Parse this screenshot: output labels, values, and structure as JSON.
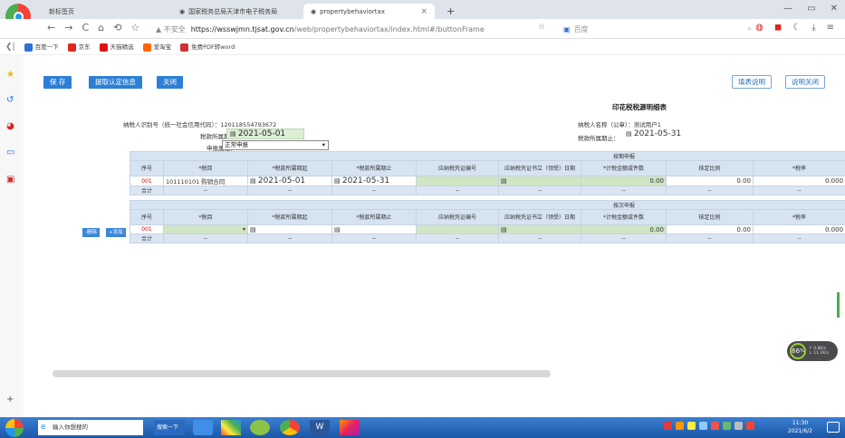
{
  "browser": {
    "tabs": [
      {
        "label": "新标签页",
        "active": false
      },
      {
        "label": "国家税务总局天津市电子税务局",
        "active": false
      },
      {
        "label": "propertybehaviortax",
        "active": true
      }
    ],
    "new_tab": "+",
    "window_controls": [
      "—",
      "▭",
      "✕"
    ],
    "nav": [
      "←",
      "→",
      "C",
      "⌂",
      "⟲",
      "☆"
    ],
    "security": "▲ 不安全",
    "url_host": "https://wsswjmn.tjsat.gov.cn",
    "url_path": "/web/propertybehaviortax/index.html#/buttonFrame",
    "search_engine": "百度",
    "bookmarks": [
      {
        "label": "百度一下",
        "color": "#2f6fd6"
      },
      {
        "label": "京东",
        "color": "#e1251b"
      },
      {
        "label": "天猫精选",
        "color": "#d11"
      },
      {
        "label": "爱淘宝",
        "color": "#f60"
      },
      {
        "label": "免费PDF转word",
        "color": "#c33"
      }
    ]
  },
  "toolbar": {
    "save_label": "保 存",
    "extract_label": "提取认定信息",
    "close_label": "关闭",
    "help_label": "填表说明",
    "help_close_label": "说明关闭"
  },
  "form": {
    "title": "印花税税源明细表",
    "taxpayer_id_label": "纳税人识别号（统一社会信用代码）：",
    "taxpayer_id": "120118554793672",
    "taxpayer_name_label": "纳税人名称（公章）：",
    "taxpayer_name": "测试用户1",
    "period_start_label": "税款所属期起：",
    "period_start": "2021-05-01",
    "period_end_label": "税款所属期止：",
    "period_end": "2021-05-31",
    "declare_attr_label": "申报属性：",
    "declare_attr_value": "正常申报"
  },
  "headers": [
    "序号",
    "*税目",
    "*税款所属期起",
    "*税款所属期止",
    "应纳税凭证编号",
    "应纳税凭证书立（领受）日期",
    "*计税金额或件数",
    "核定比例",
    "*税率"
  ],
  "period_section": {
    "title": "按期申报",
    "row": {
      "no": "001",
      "item": "101110101 购销合同",
      "start": "2021-05-01",
      "end": "2021-05-31",
      "voucher_no": "",
      "voucher_date": "",
      "amount": "0.00",
      "ratio": "0.00",
      "rate": "0.000"
    },
    "sum_label": "合计",
    "sum_values": [
      "--",
      "--",
      "--",
      "--",
      "--",
      "--",
      "--",
      "--"
    ]
  },
  "each_section": {
    "title": "按次申报",
    "delete_label": "-删除",
    "add_label": "+添加",
    "row": {
      "no": "001",
      "item": "",
      "start": "",
      "end": "",
      "voucher_no": "",
      "voucher_date": "",
      "amount": "0.00",
      "ratio": "0.00",
      "rate": "0.000"
    },
    "sum_label": "合计",
    "sum_values": [
      "--",
      "--",
      "--",
      "--",
      "--",
      "--",
      "--",
      "--"
    ]
  },
  "speed_widget": {
    "value": "66",
    "unit": "%",
    "up": "↑ 0.8K/s",
    "down": "↓ 11.1K/s"
  },
  "taskbar": {
    "search_placeholder": "输入你想搜的",
    "search_button": "搜索一下",
    "time": "11:30",
    "date": "2021/6/2"
  }
}
